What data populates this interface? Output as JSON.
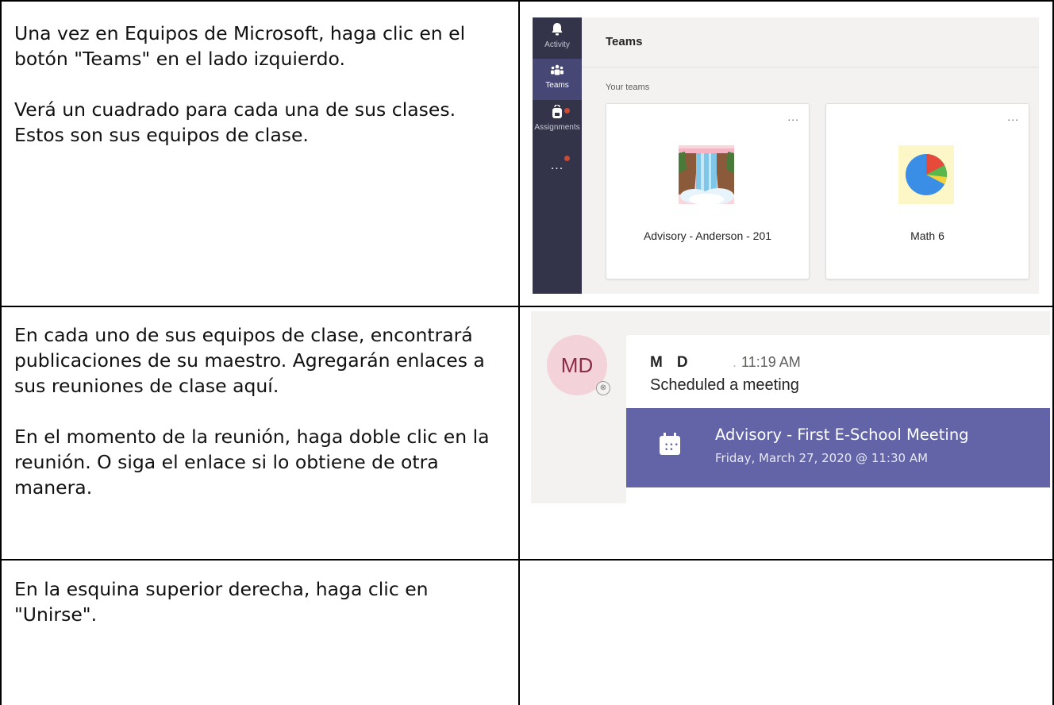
{
  "rows": [
    {
      "paragraphs": [
        "Una vez en Equipos de Microsoft, haga clic en el botón \"Teams\" en el lado izquierdo.",
        "Verá un cuadrado para cada una de sus clases. Estos son sus equipos de clase."
      ]
    },
    {
      "paragraphs": [
        "En cada uno de sus equipos de clase, encontrará publicaciones de su maestro. Agregarán enlaces a sus reuniones de clase aquí.",
        "En el momento de la reunión, haga doble clic en la reunión. O siga el enlace si lo obtiene de otra manera."
      ]
    },
    {
      "paragraphs": [
        "En la esquina superior derecha, haga clic en \"Unirse\"."
      ]
    }
  ],
  "teams_screenshot": {
    "rail": [
      {
        "label": "Activity",
        "icon": "bell-icon"
      },
      {
        "label": "Teams",
        "icon": "teams-icon"
      },
      {
        "label": "Assignments",
        "icon": "backpack-icon"
      }
    ],
    "rail_more": "...",
    "header_title": "Teams",
    "section_label": "Your teams",
    "cards": [
      {
        "name": "Advisory - Anderson - 201",
        "more": "...",
        "image": "waterfall-image"
      },
      {
        "name": "Math 6",
        "more": "...",
        "image": "pie-chart-image"
      }
    ],
    "colors": {
      "rail": "#33344a",
      "rail_active": "#464775",
      "notification_dot": "#cc4a31"
    }
  },
  "post_screenshot": {
    "avatar_initials": "MD",
    "status_glyph": "⊗",
    "author_first": "M",
    "author_last": "D",
    "time": "11:19 AM",
    "action": "Scheduled a meeting",
    "meeting_title": "Advisory - First E-School Meeting",
    "meeting_datetime": "Friday, March 27, 2020 @ 11:30 AM",
    "colors": {
      "meeting_banner": "#6264a7",
      "avatar_bg": "#f4d2da",
      "avatar_text": "#8b2c4a"
    }
  }
}
